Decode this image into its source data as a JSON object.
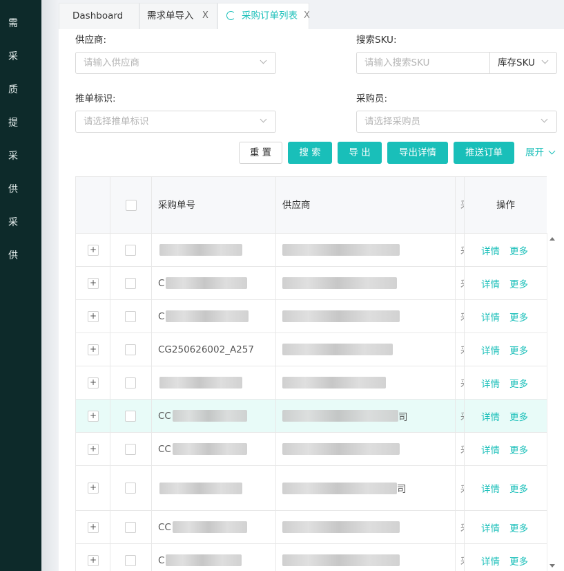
{
  "sidebar": {
    "items": [
      {
        "label": "需"
      },
      {
        "label": "采"
      },
      {
        "label": "质"
      },
      {
        "label": "提"
      },
      {
        "label": "采"
      },
      {
        "label": "供"
      },
      {
        "label": "采"
      },
      {
        "label": "供"
      }
    ]
  },
  "tabs": [
    {
      "label": "Dashboard",
      "closable": false,
      "active": false
    },
    {
      "label": "需求单导入",
      "closable": true,
      "active": false
    },
    {
      "label": "采购订单列表",
      "closable": true,
      "active": true,
      "icon": "refresh-icon"
    }
  ],
  "close_glyph": "X",
  "filters": {
    "supplier": {
      "label": "供应商:",
      "placeholder": "请输入供应商"
    },
    "sku": {
      "label": "搜索SKU:",
      "placeholder": "请输入搜索SKU",
      "select_value": "库存SKU"
    },
    "push_flag": {
      "label": "推单标识:",
      "placeholder": "请选择推单标识"
    },
    "buyer": {
      "label": "采购员:",
      "placeholder": "请选择采购员"
    }
  },
  "buttons": {
    "reset": "重 置",
    "search": "搜 索",
    "export": "导 出",
    "export_detail": "导出详情",
    "push_order": "推送订单",
    "expand": "展开"
  },
  "table": {
    "columns": {
      "order_no": "采购单号",
      "supplier": "供应商",
      "truncated": "采",
      "actions": "操作"
    },
    "rows": [
      {
        "order_no": "",
        "supplier": "",
        "truncated": "采",
        "highlight": false
      },
      {
        "order_no": "C",
        "supplier": "",
        "truncated": "采",
        "highlight": false
      },
      {
        "order_no": "C",
        "supplier": "",
        "truncated": "采",
        "highlight": false
      },
      {
        "order_no": "CG250626002_A257",
        "supplier": "",
        "truncated": "采",
        "highlight": false
      },
      {
        "order_no": "",
        "supplier": "",
        "truncated": "采",
        "highlight": false
      },
      {
        "order_no": "CC",
        "supplier": "司",
        "truncated": "采",
        "highlight": true
      },
      {
        "order_no": "CC",
        "supplier": "",
        "truncated": "采",
        "highlight": false
      },
      {
        "order_no": "",
        "supplier": "司",
        "truncated": "采",
        "highlight": false
      },
      {
        "order_no": "CC",
        "supplier": "",
        "truncated": "采",
        "highlight": false
      },
      {
        "order_no": "C",
        "supplier": "",
        "truncated": "采",
        "highlight": false
      }
    ],
    "row_actions": {
      "detail": "详情",
      "more": "更多"
    },
    "expand_glyph": "+"
  },
  "colors": {
    "accent": "#19bfb9",
    "sidebar_bg": "#0d2a2a",
    "highlight_row": "#e8fbf8"
  }
}
